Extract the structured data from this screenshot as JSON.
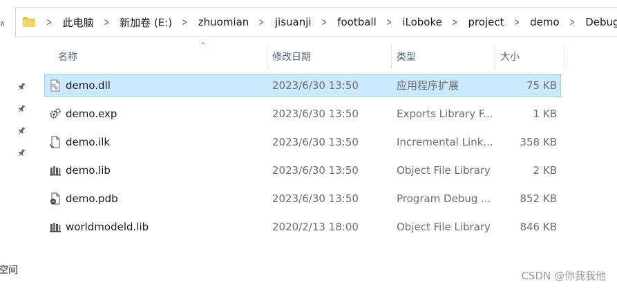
{
  "breadcrumb": [
    "此电脑",
    "新加卷 (E:)",
    "zhuomian",
    "jisuanji",
    "football",
    "iLoboke",
    "project",
    "demo",
    "Debug"
  ],
  "columns": {
    "name": "名称",
    "date": "修改日期",
    "type": "类型",
    "size": "大小"
  },
  "files": [
    {
      "name": "demo.dll",
      "date": "2023/6/30 13:50",
      "type": "应用程序扩展",
      "size": "75 KB",
      "icon": "dll-file-icon",
      "selected": true
    },
    {
      "name": "demo.exp",
      "date": "2023/6/30 13:50",
      "type": "Exports Library F...",
      "size": "1 KB",
      "icon": "exp-file-icon",
      "selected": false
    },
    {
      "name": "demo.ilk",
      "date": "2023/6/30 13:50",
      "type": "Incremental Link...",
      "size": "358 KB",
      "icon": "ilk-file-icon",
      "selected": false
    },
    {
      "name": "demo.lib",
      "date": "2023/6/30 13:50",
      "type": "Object File Library",
      "size": "2 KB",
      "icon": "lib-file-icon",
      "selected": false
    },
    {
      "name": "demo.pdb",
      "date": "2023/6/30 13:50",
      "type": "Program Debug ...",
      "size": "852 KB",
      "icon": "pdb-file-icon",
      "selected": false
    },
    {
      "name": "worldmodeld.lib",
      "date": "2020/2/13 18:00",
      "type": "Object File Library",
      "size": "846 KB",
      "icon": "lib-file-icon",
      "selected": false
    }
  ],
  "left_pane": {
    "partial_label": "空间"
  },
  "watermark": "CSDN @你我我他",
  "colors": {
    "selection": "#cce8ff",
    "selection_border": "#99d1ff",
    "header_text": "#4c607a",
    "folder": "#f0c24a"
  }
}
